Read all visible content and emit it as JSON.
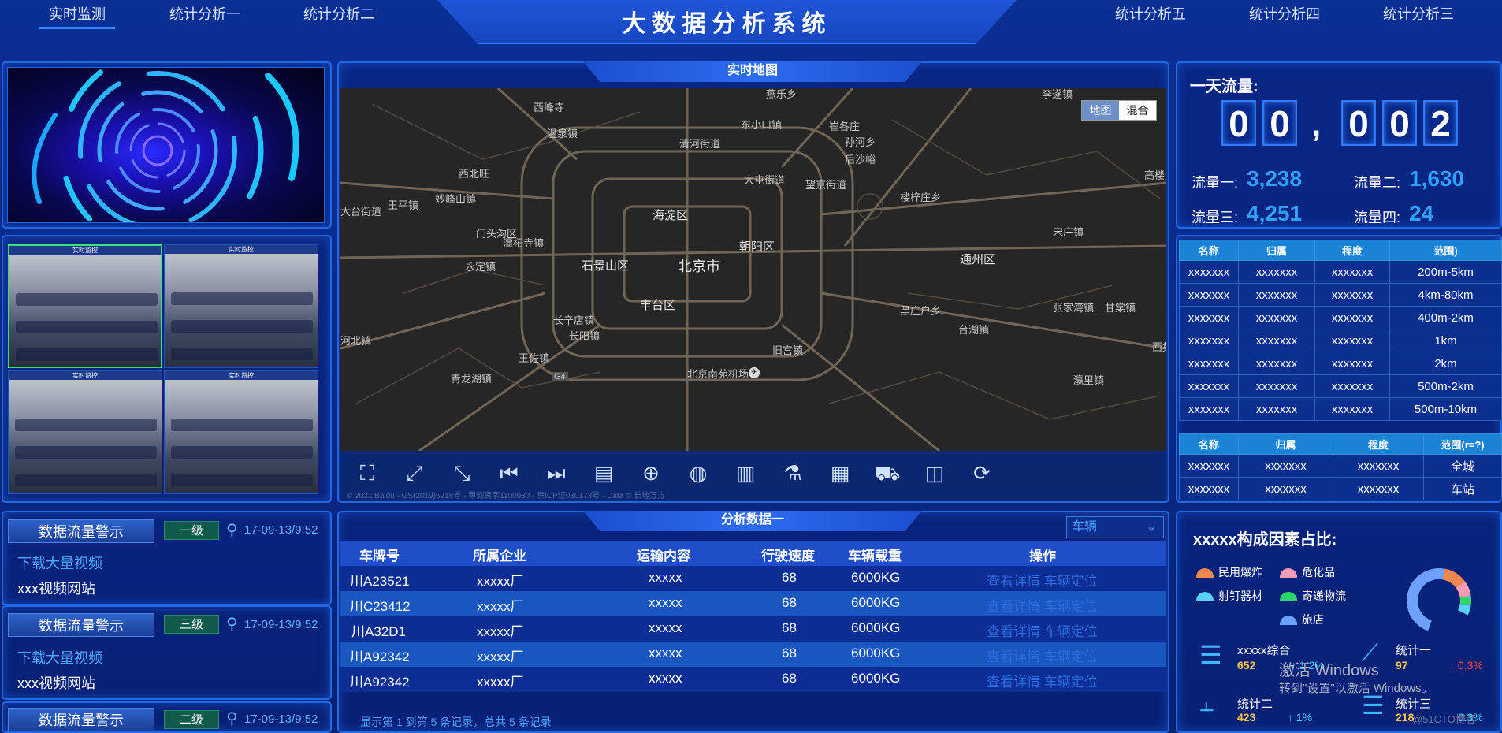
{
  "nav": {
    "items": [
      "实时监测",
      "统计分析一",
      "统计分析二",
      "统计分析五",
      "统计分析四",
      "统计分析三"
    ],
    "title": "大数据分析系统"
  },
  "cameras": {
    "title": "实时监控"
  },
  "alerts": [
    {
      "tag": "数据流量警示",
      "level": "一级",
      "time": "17-09-13/9:52",
      "link": "下载大量视频",
      "site": "xxx视频网站"
    },
    {
      "tag": "数据流量警示",
      "level": "三级",
      "time": "17-09-13/9:52",
      "link": "下载大量视频",
      "site": "xxx视频网站"
    },
    {
      "tag": "数据流量警示",
      "level": "二级",
      "time": "17-09-13/9:52"
    }
  ],
  "map": {
    "title": "实时地图",
    "switch": [
      "地图",
      "混合"
    ],
    "labels": [
      "燕乐乡",
      "李遂镇",
      "西峰寺",
      "东小口镇",
      "崔各庄",
      "温泉镇",
      "清河街道",
      "孙河乡",
      "后沙峪",
      "西北旺",
      "大屯街道",
      "望京街道",
      "王平镇",
      "妙峰山镇",
      "海淀区",
      "楼梓庄乡",
      "大台街道",
      "门头沟区",
      "宋庄镇",
      "高楼金",
      "潭柘寺镇",
      "永定镇",
      "石景山区",
      "北京市",
      "朝阳区",
      "通州区",
      "张家湾镇",
      "长辛店镇",
      "丰台区",
      "黑庄户乡",
      "台湖镇",
      "甘棠镇",
      "河北镇",
      "长阳镇",
      "王佐镇",
      "旧宫镇",
      "青龙湖镇",
      "北京南苑机场",
      "瀛里镇",
      "西集",
      "G4"
    ],
    "copyright": "© 2021 Baidu - GS(2019)5218号 - 甲测资字1100930 - 京ICP证030173号 - Data © 长地万方"
  },
  "analysis": {
    "title": "分析数据一",
    "select_value": "车辆",
    "headers": [
      "车牌号",
      "所属企业",
      "运输内容",
      "行驶速度",
      "车辆载重",
      "操作"
    ],
    "rows": [
      [
        "川A23521",
        "xxxxx厂",
        "xxxxx",
        "68",
        "6000KG",
        "查看详情 车辆定位"
      ],
      [
        "川C23412",
        "xxxxx厂",
        "xxxxx",
        "68",
        "6000KG",
        "查看详情 车辆定位"
      ],
      [
        "川A32D1",
        "xxxxx厂",
        "xxxxx",
        "68",
        "6000KG",
        "查看详情 车辆定位"
      ],
      [
        "川A92342",
        "xxxxx厂",
        "xxxxx",
        "68",
        "6000KG",
        "查看详情 车辆定位"
      ],
      [
        "川A92342",
        "xxxxx厂",
        "xxxxx",
        "68",
        "6000KG",
        "查看详情 车辆定位"
      ]
    ],
    "footer": "显示第 1 到第 5 条记录，总共 5 条记录"
  },
  "flow": {
    "title": "一天流量:",
    "digits": [
      "0",
      "0",
      ",",
      "0",
      "0",
      "2"
    ],
    "items": [
      {
        "label": "流量一:",
        "value": "3,238"
      },
      {
        "label": "流量二:",
        "value": "1,630"
      },
      {
        "label": "流量三:",
        "value": "4,251"
      },
      {
        "label": "流量四:",
        "value": "24"
      }
    ]
  },
  "table1": {
    "headers": [
      "名称",
      "归属",
      "程度",
      "范围)"
    ],
    "rows": [
      [
        "xxxxxxx",
        "xxxxxxx",
        "xxxxxxx",
        "200m-5km"
      ],
      [
        "xxxxxxx",
        "xxxxxxx",
        "xxxxxxx",
        "4km-80km"
      ],
      [
        "xxxxxxx",
        "xxxxxxx",
        "xxxxxxx",
        "400m-2km"
      ],
      [
        "xxxxxxx",
        "xxxxxxx",
        "xxxxxxx",
        "1km"
      ],
      [
        "xxxxxxx",
        "xxxxxxx",
        "xxxxxxx",
        "2km"
      ],
      [
        "xxxxxxx",
        "xxxxxxx",
        "xxxxxxx",
        "500m-2km"
      ],
      [
        "xxxxxxx",
        "xxxxxxx",
        "xxxxxxx",
        "500m-10km"
      ]
    ]
  },
  "table2": {
    "headers": [
      "名称",
      "归属",
      "程度",
      "范围(r=?)"
    ],
    "rows": [
      [
        "xxxxxxx",
        "xxxxxxx",
        "xxxxxxx",
        "全城"
      ],
      [
        "xxxxxxx",
        "xxxxxxx",
        "xxxxxxx",
        "车站"
      ]
    ]
  },
  "composition": {
    "title": "xxxxx构成因素占比:",
    "legend": [
      {
        "label": "民用爆炸",
        "color": "#f0854e"
      },
      {
        "label": "危化品",
        "color": "#f59bb4"
      },
      {
        "label": "射钉器材",
        "color": "#5bd0f5"
      },
      {
        "label": "寄递物流",
        "color": "#2fd46b"
      },
      {
        "label": "旅店",
        "color": "#6ea0ff"
      }
    ],
    "stats": [
      {
        "label": "xxxxx综合",
        "value": "652",
        "pct": "↑ 1.2%"
      },
      {
        "label": "统计一",
        "value": "97",
        "pct": "↓ 0.3%"
      },
      {
        "label": "统计二",
        "value": "423",
        "pct": "↑ 1%"
      },
      {
        "label": "统计三",
        "value": "218",
        "pct": "↑ 0.3%"
      }
    ]
  },
  "watermark": {
    "line1": "激活 Windows",
    "line2": "转到\"设置\"以激活 Windows。",
    "blog": "@51CTO博客"
  }
}
